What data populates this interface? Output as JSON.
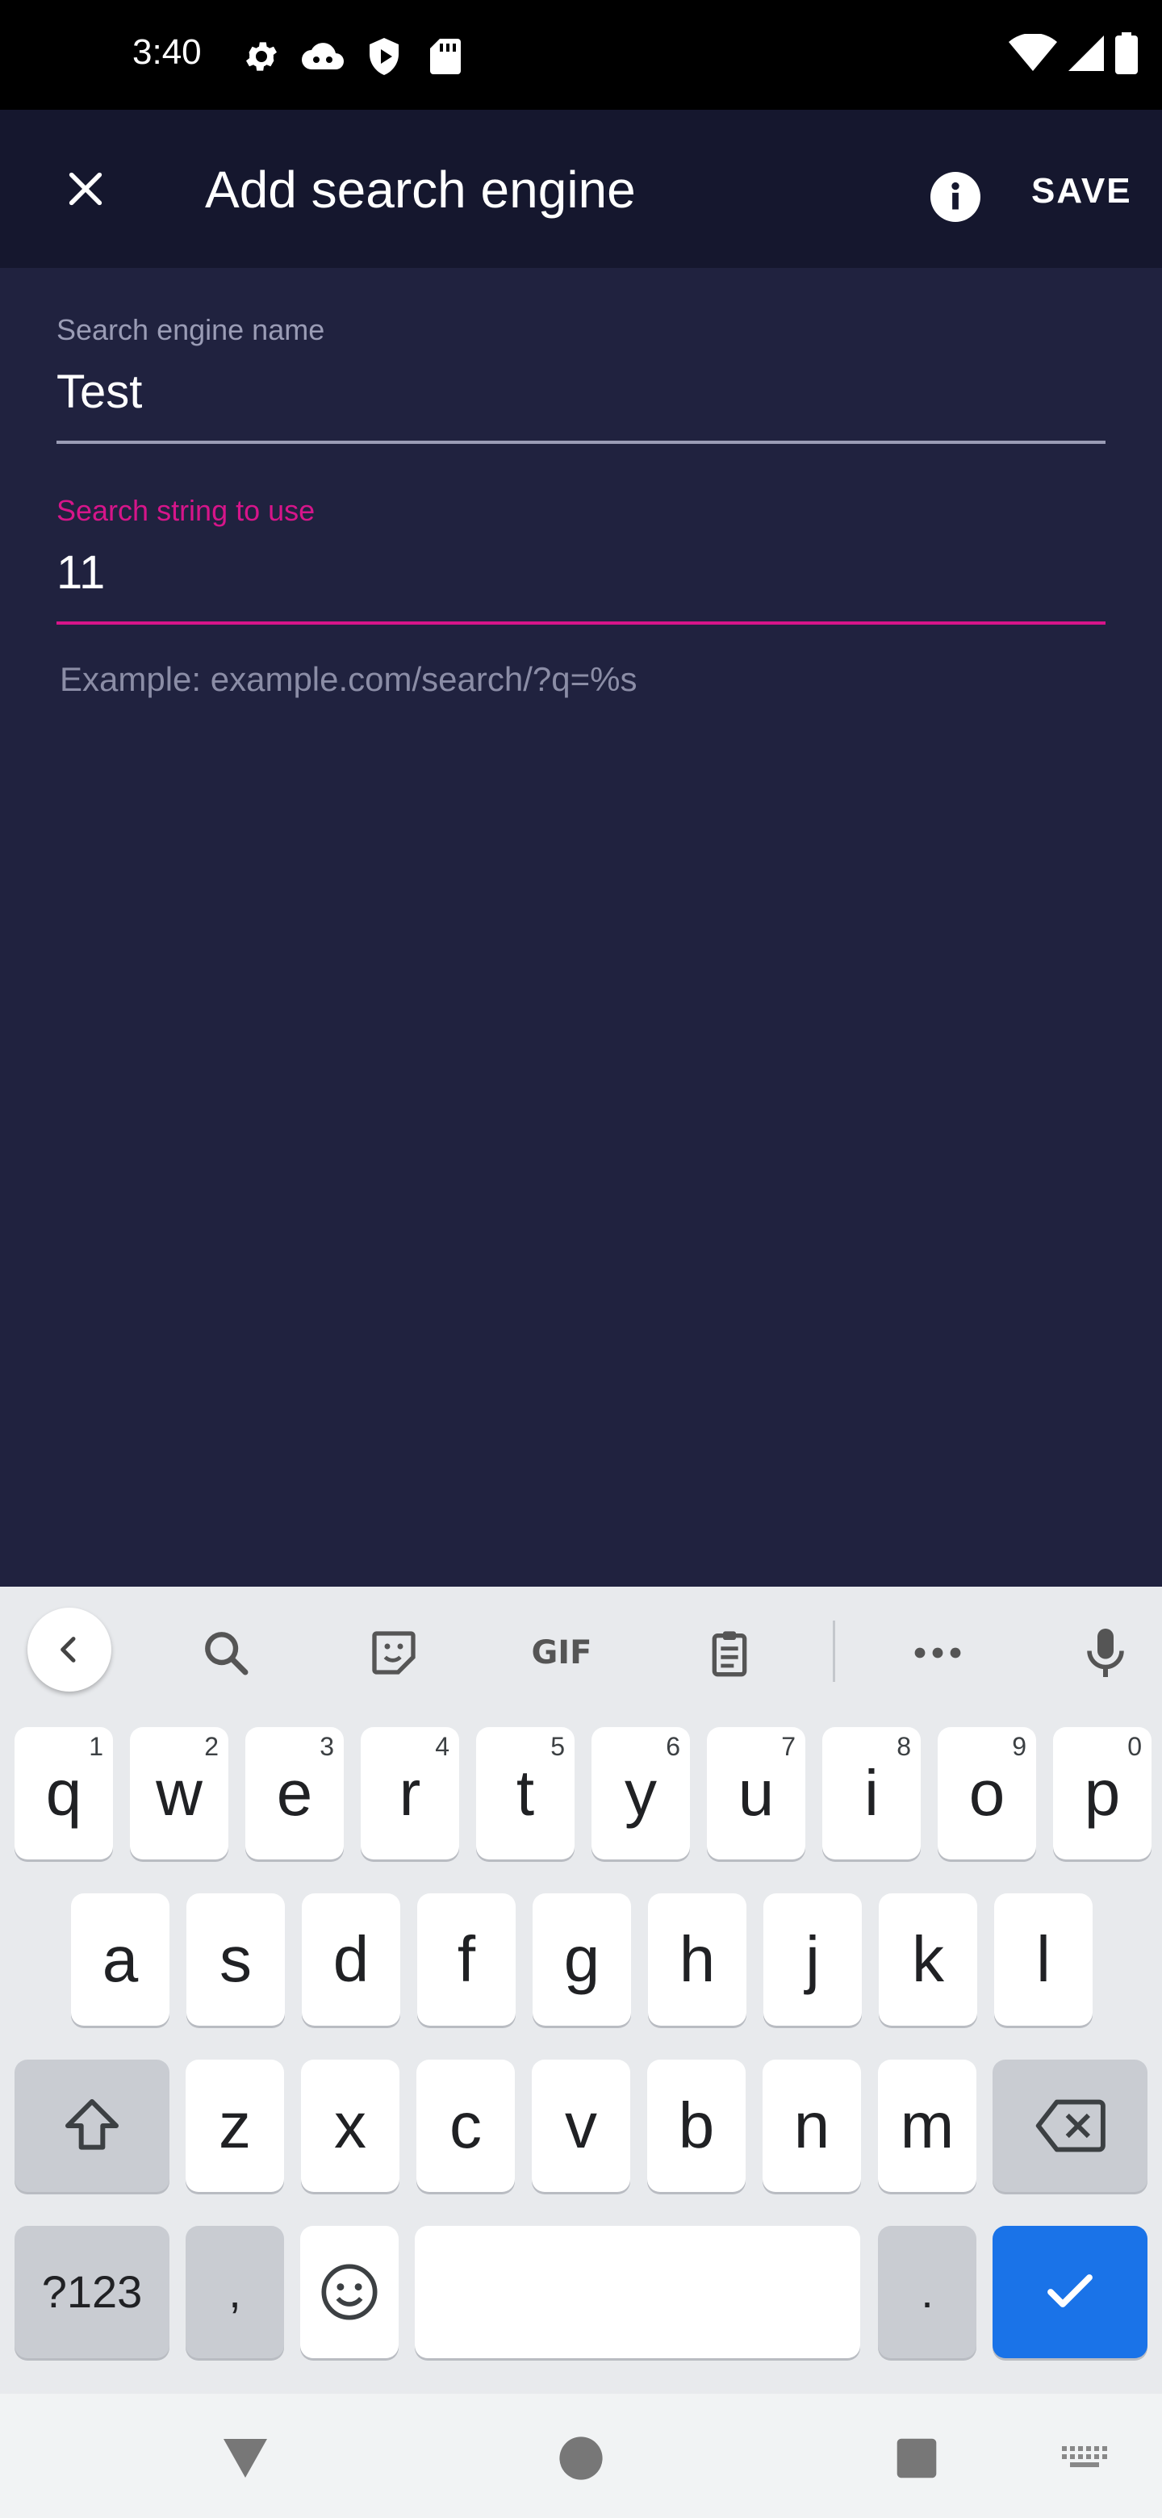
{
  "status_bar": {
    "time": "3:40",
    "left_icons": [
      "settings-icon",
      "cloud-icon",
      "shield-play-icon",
      "sd-card-icon"
    ],
    "right_icons": [
      "wifi-icon",
      "cellular-signal-icon",
      "battery-icon"
    ]
  },
  "app_bar": {
    "title": "Add search engine",
    "save_label": "SAVE",
    "close_icon": "close-icon",
    "info_icon": "info-icon"
  },
  "form": {
    "name_field": {
      "label": "Search engine name",
      "value": "Test"
    },
    "string_field": {
      "label": "Search string to use",
      "value": "11",
      "helper": "Example: example.com/search/?q=%s"
    }
  },
  "colors": {
    "accent": "#d6158a",
    "background": "#20223f",
    "app_bar": "#15172e",
    "keyboard_action": "#1a73e8"
  },
  "keyboard": {
    "toolbar_icons": [
      "back-chevron-icon",
      "search-icon",
      "sticker-icon",
      "gif-icon",
      "clipboard-icon",
      "more-icon",
      "mic-icon"
    ],
    "gif_label": "GIF",
    "row1": [
      {
        "key": "q",
        "hint": "1"
      },
      {
        "key": "w",
        "hint": "2"
      },
      {
        "key": "e",
        "hint": "3"
      },
      {
        "key": "r",
        "hint": "4"
      },
      {
        "key": "t",
        "hint": "5"
      },
      {
        "key": "y",
        "hint": "6"
      },
      {
        "key": "u",
        "hint": "7"
      },
      {
        "key": "i",
        "hint": "8"
      },
      {
        "key": "o",
        "hint": "9"
      },
      {
        "key": "p",
        "hint": "0"
      }
    ],
    "row2": [
      "a",
      "s",
      "d",
      "f",
      "g",
      "h",
      "j",
      "k",
      "l"
    ],
    "row3": [
      "z",
      "x",
      "c",
      "v",
      "b",
      "n",
      "m"
    ],
    "symbols_label": "?123",
    "comma_label": ",",
    "period_label": "."
  },
  "nav_bar": {
    "icons": [
      "back-triangle-icon",
      "home-circle-icon",
      "recents-square-icon",
      "keyboard-switch-icon"
    ]
  }
}
